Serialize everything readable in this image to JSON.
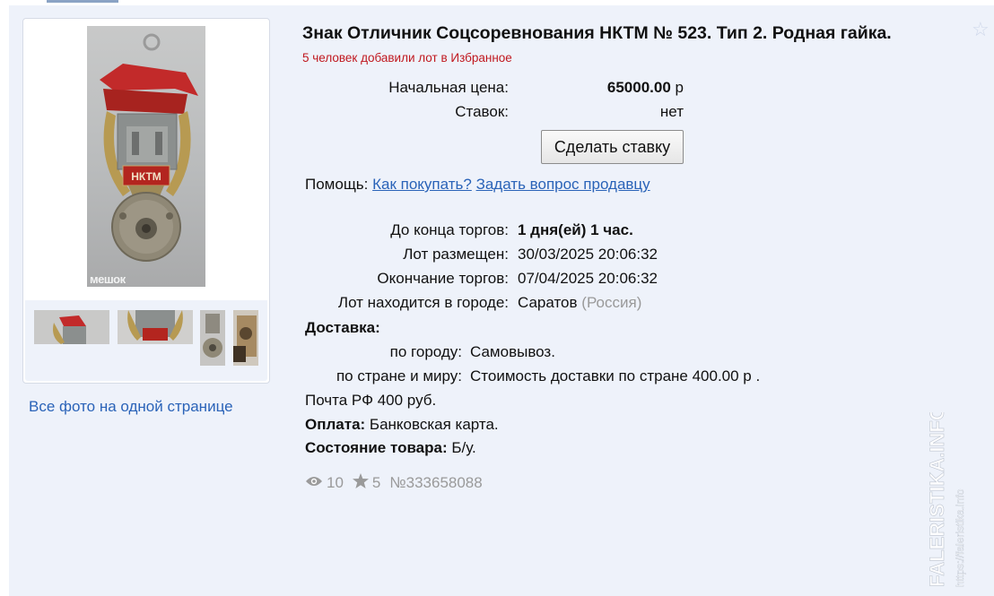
{
  "lot": {
    "title": "Знак Отличник Соцсоревнования НКТМ № 523. Тип 2. Родная гайка.",
    "favorites_note": "5 человек добавили лот в Избранное",
    "start_price_label": "Начальная цена:",
    "start_price_value": "65000.00",
    "currency": "р",
    "bids_label": "Ставок:",
    "bids_value": "нет",
    "bid_button": "Сделать ставку"
  },
  "help": {
    "label": "Помощь:",
    "how_to_buy": "Как покупать?",
    "ask_seller": "Задать вопрос продавцу"
  },
  "auction": {
    "ends_in_label": "До конца торгов:",
    "ends_in_value": "1 дня(ей) 1 час.",
    "posted_label": "Лот размещен:",
    "posted_value": "30/03/2025 20:06:32",
    "end_label": "Окончание торгов:",
    "end_value": "07/04/2025 20:06:32",
    "city_label": "Лот находится в городе:",
    "city_value": "Саратов",
    "country_value": "(Россия)"
  },
  "delivery": {
    "heading": "Доставка:",
    "city_label": "по городу:",
    "city_value": "Самовывоз.",
    "world_label": "по стране и миру:",
    "world_value": "Стоимость доставки по стране 400.00 р .",
    "post_note": "Почта РФ 400 руб.",
    "payment_label": "Оплата:",
    "payment_value": "Банковская карта.",
    "condition_label": "Состояние товара:",
    "condition_value": "Б/у."
  },
  "stats": {
    "views": "10",
    "stars": "5",
    "lot_number": "№333658088",
    "views_icon": "eye-icon",
    "stars_icon": "star-icon"
  },
  "gallery": {
    "all_photos_link": "Все фото на одной странице",
    "logo_text": "мешок"
  },
  "watermark": {
    "main": "FALERISTIKA.INFO",
    "url": "https://faleristika.info"
  },
  "colors": {
    "link": "#2a63b8",
    "favorites_note": "#c0181f",
    "panel_bg": "#eef2fa"
  }
}
